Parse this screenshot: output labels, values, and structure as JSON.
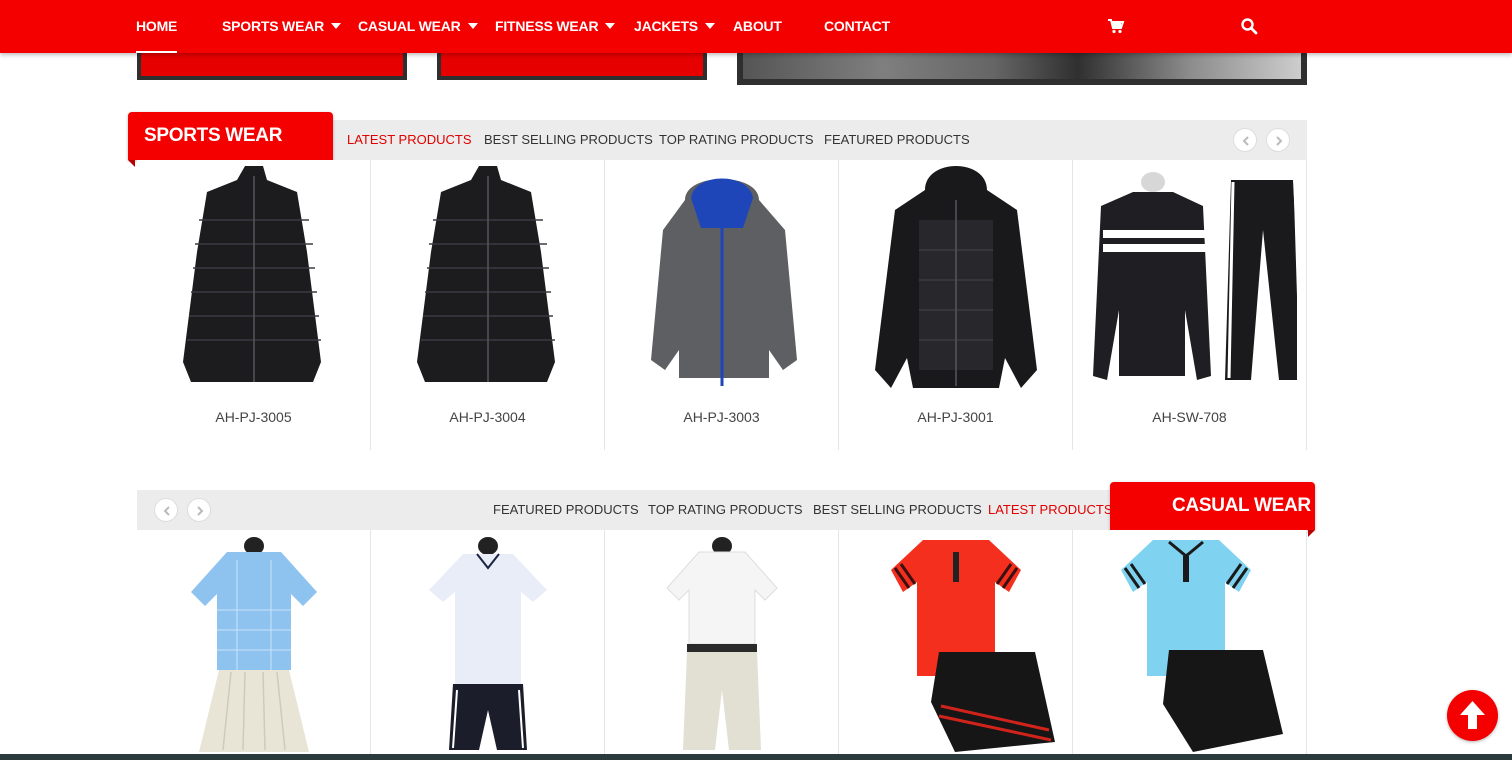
{
  "nav": {
    "items": [
      {
        "label": "HOME",
        "dropdown": false
      },
      {
        "label": "SPORTS WEAR",
        "dropdown": true
      },
      {
        "label": "CASUAL WEAR",
        "dropdown": true
      },
      {
        "label": "FITNESS WEAR",
        "dropdown": true
      },
      {
        "label": "JACKETS",
        "dropdown": true
      },
      {
        "label": "ABOUT",
        "dropdown": false
      },
      {
        "label": "CONTACT",
        "dropdown": false
      }
    ],
    "active": "HOME",
    "icons": [
      "cart-icon",
      "search-icon"
    ]
  },
  "colors": {
    "brand": "#f40000",
    "active_tab": "#e00000",
    "tab_bar": "#ececec"
  },
  "sports": {
    "title": "SPORTS WEAR",
    "tabs": [
      "LATEST PRODUCTS",
      "BEST SELLING PRODUCTS",
      "TOP RATING PRODUCTS",
      "FEATURED PRODUCTS"
    ],
    "active_tab": "LATEST PRODUCTS",
    "products": [
      "AH-PJ-3005",
      "AH-PJ-3004",
      "AH-PJ-3003",
      "AH-PJ-3001",
      "AH-SW-708"
    ]
  },
  "casual": {
    "title": "CASUAL WEAR",
    "tabs": [
      "FEATURED PRODUCTS",
      "TOP RATING PRODUCTS",
      "BEST SELLING PRODUCTS",
      "LATEST PRODUCTS"
    ],
    "active_tab": "LATEST PRODUCTS",
    "product_images": [
      "blue-check-shirt-skirt",
      "white-polo-navy-shorts",
      "white-shirt-khaki-shorts",
      "red-polo-black-shorts",
      "sky-blue-polo-black-shorts"
    ]
  }
}
